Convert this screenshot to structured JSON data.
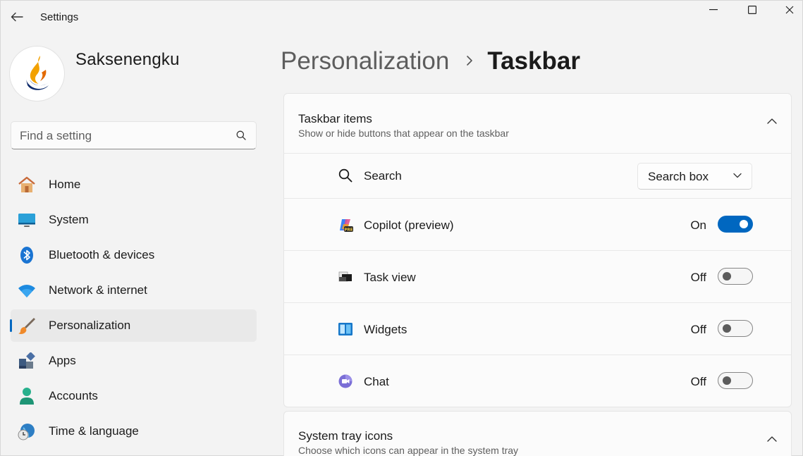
{
  "window": {
    "title": "Settings",
    "controls": [
      "minimize",
      "maximize",
      "close"
    ]
  },
  "profile": {
    "name": "Saksenengku"
  },
  "search": {
    "placeholder": "Find a setting"
  },
  "nav": {
    "items": [
      {
        "label": "Home",
        "icon": "home-icon"
      },
      {
        "label": "System",
        "icon": "system-icon"
      },
      {
        "label": "Bluetooth & devices",
        "icon": "bluetooth-icon"
      },
      {
        "label": "Network & internet",
        "icon": "wifi-icon"
      },
      {
        "label": "Personalization",
        "icon": "brush-icon",
        "active": true
      },
      {
        "label": "Apps",
        "icon": "apps-icon"
      },
      {
        "label": "Accounts",
        "icon": "accounts-icon"
      },
      {
        "label": "Time & language",
        "icon": "clock-globe-icon"
      }
    ]
  },
  "breadcrumb": {
    "parent": "Personalization",
    "current": "Taskbar"
  },
  "taskbar_items": {
    "title": "Taskbar items",
    "subtitle": "Show or hide buttons that appear on the taskbar",
    "search": {
      "label": "Search",
      "selected": "Search box"
    },
    "toggles": [
      {
        "label": "Copilot (preview)",
        "state": "On",
        "on": true,
        "icon": "copilot-icon"
      },
      {
        "label": "Task view",
        "state": "Off",
        "on": false,
        "icon": "task-view-icon"
      },
      {
        "label": "Widgets",
        "state": "Off",
        "on": false,
        "icon": "widgets-icon"
      },
      {
        "label": "Chat",
        "state": "Off",
        "on": false,
        "icon": "chat-icon"
      }
    ]
  },
  "system_tray": {
    "title": "System tray icons",
    "subtitle": "Choose which icons can appear in the system tray"
  },
  "colors": {
    "accent": "#0067c0",
    "background": "#f3f3f3",
    "card": "#fbfbfb"
  }
}
